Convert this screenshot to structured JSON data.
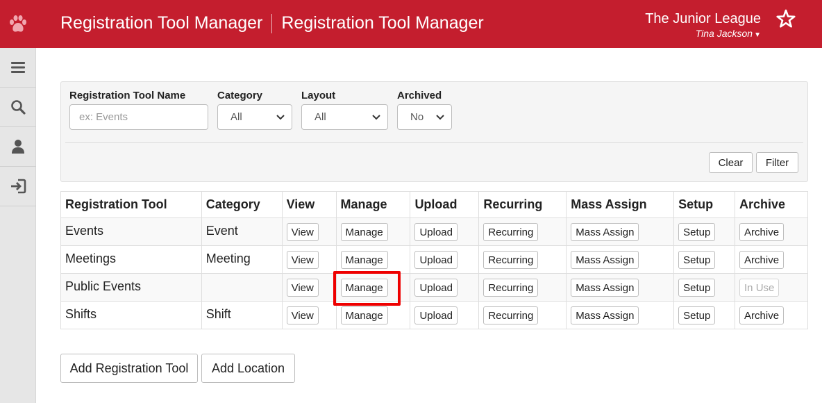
{
  "header": {
    "icon": "paw-icon",
    "title_primary": "Registration Tool Manager",
    "title_secondary": "Registration Tool Manager",
    "org_name": "The Junior League",
    "user_name": "Tina Jackson",
    "star_icon": "star-icon",
    "bg_color": "#c41e2e"
  },
  "sidebar": {
    "items": [
      {
        "icon": "menu-icon"
      },
      {
        "icon": "search-icon"
      },
      {
        "icon": "user-icon"
      },
      {
        "icon": "sign-in-icon"
      }
    ]
  },
  "filters": {
    "name_label": "Registration Tool Name",
    "name_placeholder": "ex: Events",
    "category_label": "Category",
    "category_value": "All",
    "layout_label": "Layout",
    "layout_value": "All",
    "archived_label": "Archived",
    "archived_value": "No",
    "clear_label": "Clear",
    "filter_label": "Filter"
  },
  "table": {
    "headers": [
      "Registration Tool",
      "Category",
      "View",
      "Manage",
      "Upload",
      "Recurring",
      "Mass Assign",
      "Setup",
      "Archive"
    ],
    "rows": [
      {
        "name": "Events",
        "category": "Event",
        "view": "View",
        "manage": "Manage",
        "upload": "Upload",
        "recurring": "Recurring",
        "mass_assign": "Mass Assign",
        "setup": "Setup",
        "archive": "Archive"
      },
      {
        "name": "Meetings",
        "category": "Meeting",
        "view": "View",
        "manage": "Manage",
        "upload": "Upload",
        "recurring": "Recurring",
        "mass_assign": "Mass Assign",
        "setup": "Setup",
        "archive": "Archive"
      },
      {
        "name": "Public Events",
        "category": "",
        "view": "View",
        "manage": "Manage",
        "upload": "Upload",
        "recurring": "Recurring",
        "mass_assign": "Mass Assign",
        "setup": "Setup",
        "archive": "In Use"
      },
      {
        "name": "Shifts",
        "category": "Shift",
        "view": "View",
        "manage": "Manage",
        "upload": "Upload",
        "recurring": "Recurring",
        "mass_assign": "Mass Assign",
        "setup": "Setup",
        "archive": "Archive"
      }
    ]
  },
  "actions": {
    "add_tool_label": "Add Registration Tool",
    "add_location_label": "Add Location"
  },
  "highlight_color": "#ee0000"
}
